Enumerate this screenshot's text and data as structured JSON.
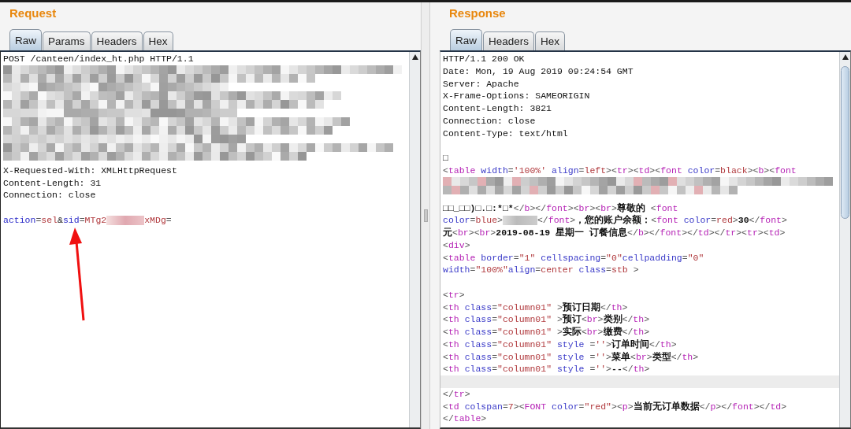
{
  "request": {
    "title": "Request",
    "tabs": [
      {
        "label": "Raw",
        "selected": true
      },
      {
        "label": "Params",
        "selected": false
      },
      {
        "label": "Headers",
        "selected": false
      },
      {
        "label": "Hex",
        "selected": false
      }
    ],
    "lines": [
      {
        "kind": "plain",
        "parts": [
          "POST /canteen/index_ht.php HTTP/1.1"
        ]
      },
      {
        "kind": "redacted"
      },
      {
        "kind": "redacted"
      },
      {
        "kind": "redacted"
      },
      {
        "kind": "redacted"
      },
      {
        "kind": "redacted"
      },
      {
        "kind": "redacted"
      },
      {
        "kind": "redacted"
      },
      {
        "kind": "redacted"
      },
      {
        "kind": "plain",
        "parts": [
          "X-Requested-With: XMLHttpRequest"
        ]
      },
      {
        "kind": "plain",
        "parts": [
          "Content-Length: 31"
        ]
      },
      {
        "kind": "plain",
        "parts": [
          "Connection: close"
        ]
      },
      {
        "kind": "blank"
      },
      {
        "kind": "params",
        "parts": [
          "action=sel&sid=MTg2",
          "xMDg="
        ]
      }
    ],
    "annotation": {
      "kind": "arrow"
    }
  },
  "response": {
    "title": "Response",
    "tabs": [
      {
        "label": "Raw",
        "selected": true
      },
      {
        "label": "Headers",
        "selected": false
      },
      {
        "label": "Hex",
        "selected": false
      }
    ],
    "lines": [
      {
        "kind": "plain",
        "parts": [
          "HTTP/1.1 200 OK"
        ]
      },
      {
        "kind": "plain",
        "parts": [
          "Date: Mon, 19 Aug 2019 09:24:54 GMT"
        ]
      },
      {
        "kind": "plain",
        "parts": [
          "Server: Apache"
        ]
      },
      {
        "kind": "plain",
        "parts": [
          "X-Frame-Options: SAMEORIGIN"
        ]
      },
      {
        "kind": "plain",
        "parts": [
          "Content-Length: 3821"
        ]
      },
      {
        "kind": "plain",
        "parts": [
          "Connection: close"
        ]
      },
      {
        "kind": "plain",
        "parts": [
          "Content-Type: text/html"
        ]
      },
      {
        "kind": "blank"
      },
      {
        "kind": "html",
        "parts": [
          "□"
        ]
      },
      {
        "kind": "html",
        "parts": [
          "<table width='100%' align=left><tr><td><font color=black><b><font"
        ]
      },
      {
        "kind": "redacted"
      },
      {
        "kind": "redacted"
      },
      {
        "kind": "html",
        "parts": [
          "□□_□□)□.□:*□*</b></font><br><br>尊敬的 <font"
        ]
      },
      {
        "kind": "html",
        "parts": [
          "color=blue>",
          "</font>，您的账户余额：<font color=red>30</font>"
        ]
      },
      {
        "kind": "html",
        "parts": [
          "元<br><br>2019-08-19 星期一 订餐信息</b></font></td></tr><tr><td>"
        ]
      },
      {
        "kind": "html",
        "parts": [
          "<div>"
        ]
      },
      {
        "kind": "html",
        "parts": [
          "<table border=\"1\" cellspacing=\"0\"cellpadding=\"0\""
        ]
      },
      {
        "kind": "html",
        "parts": [
          "width=\"100%\"align=center class=stb >"
        ]
      },
      {
        "kind": "blank"
      },
      {
        "kind": "html",
        "parts": [
          "<tr>"
        ]
      },
      {
        "kind": "html",
        "parts": [
          "<th class=\"column01\" >预订日期</th>"
        ]
      },
      {
        "kind": "html",
        "parts": [
          "<th class=\"column01\" >预订<br>类别</th>"
        ]
      },
      {
        "kind": "html",
        "parts": [
          "<th class=\"column01\" >实际<br>缴费</th>"
        ]
      },
      {
        "kind": "html",
        "parts": [
          "<th class=\"column01\" style =''>订单时间</th>"
        ]
      },
      {
        "kind": "html",
        "parts": [
          "<th class=\"column01\" style =''>菜单<br>类型</th>"
        ]
      },
      {
        "kind": "html",
        "parts": [
          "<th class=\"column01\" style =''>--</th>"
        ]
      },
      {
        "kind": "caret-line"
      },
      {
        "kind": "html",
        "parts": [
          "</tr>"
        ]
      },
      {
        "kind": "html",
        "parts": [
          "<td colspan=7><FONT color=\"red\"><p>当前无订单数据</p></font></td>"
        ]
      },
      {
        "kind": "html",
        "parts": [
          "</table>"
        ]
      }
    ]
  }
}
